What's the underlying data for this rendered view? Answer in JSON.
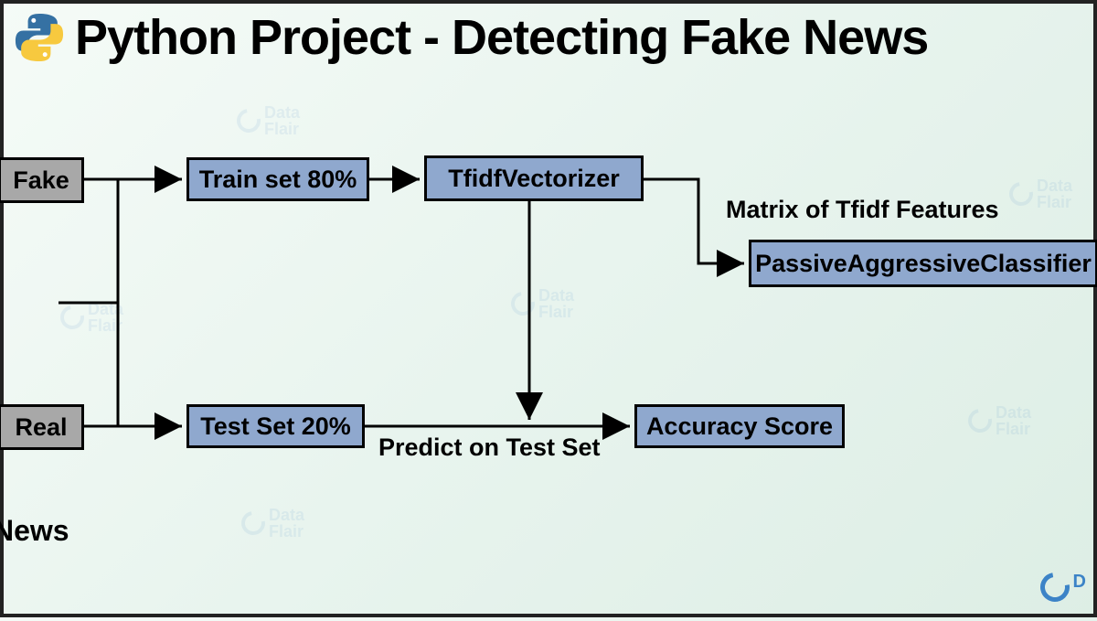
{
  "title": "Python Project - Detecting Fake News",
  "nodes": {
    "fake": "Fake",
    "real": "Real",
    "train": "Train set 80%",
    "test": "Test Set 20%",
    "tfidf": "TfidfVectorizer",
    "classifier": "PassiveAggressiveClassifier",
    "accuracy": "Accuracy Score"
  },
  "labels": {
    "matrix": "Matrix of Tfidf Features",
    "predict": "Predict on Test Set",
    "news": "News"
  },
  "watermark": "Data\nFlair"
}
